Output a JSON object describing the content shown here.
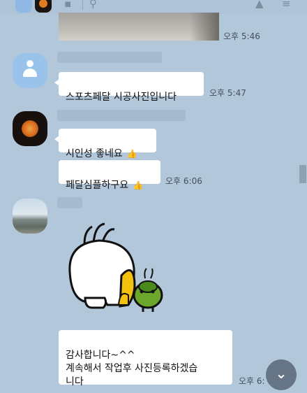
{
  "toolbar": {
    "folder_icon": "folder-icon",
    "search_icon": "search-icon",
    "bell_icon": "bell-icon",
    "menu_icon": "menu-icon"
  },
  "messages": [
    {
      "type": "photo",
      "time": "오후 5:46"
    },
    {
      "sender_avatar": "default-avatar",
      "text": "스포츠페달 시공사진입니다",
      "time": "오후 5:47"
    },
    {
      "sender_avatar": "orange-ring-avatar",
      "text": "시인성 좋네요",
      "thumb": "👍"
    },
    {
      "text": "페달심플하구요",
      "thumb": "👍",
      "time": "오후 6:06"
    },
    {
      "sender_avatar": "landscape-avatar",
      "sticker": "cartoon-sticker"
    },
    {
      "text": "감사합니다~^^\n계속해서 작업후 사진등록하겠습\n니다",
      "time": "오후 6:"
    }
  ],
  "scroll_down_icon": "chevron-down-icon",
  "colors": {
    "background": "#b2c7da",
    "bubble": "#ffffff",
    "time_text": "#43505c"
  }
}
